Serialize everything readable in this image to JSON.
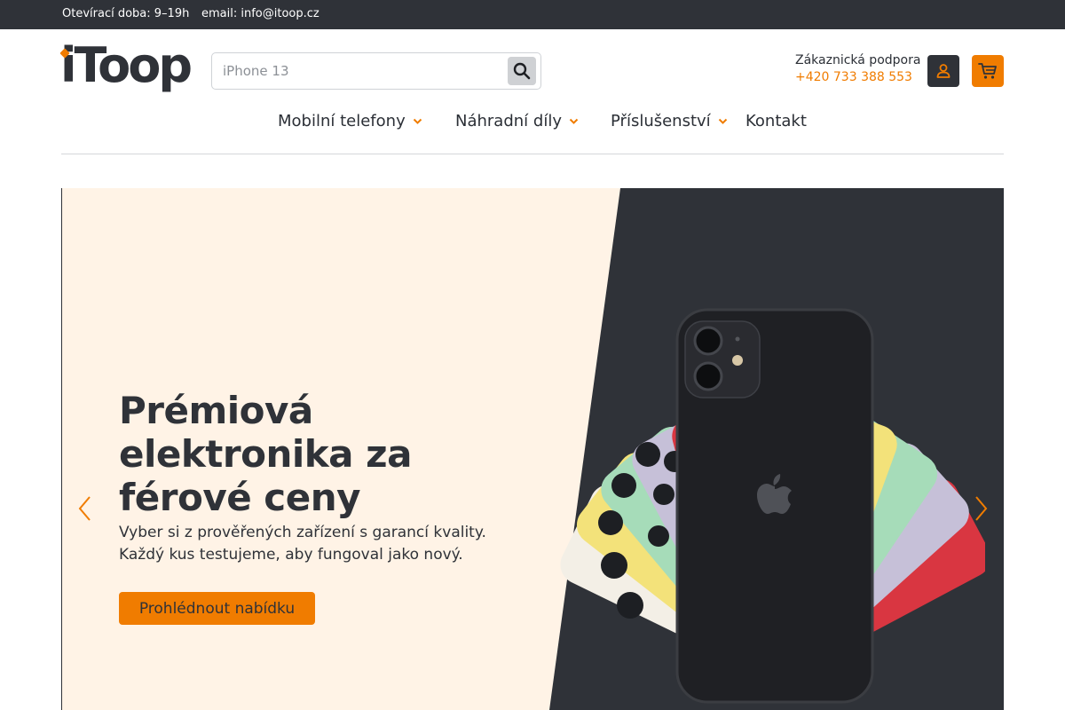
{
  "topbar": {
    "hours": "Otevírací doba: 9–19h",
    "email": "email: info@itoop.cz"
  },
  "header": {
    "logo_text": "iToop",
    "search": {
      "placeholder": "iPhone 13",
      "icon": "search-icon"
    },
    "support": {
      "label": "Zákaznická podpora",
      "phone": "+420 733 388 553"
    },
    "user_icon": "user-icon",
    "cart_icon": "cart-icon"
  },
  "nav": {
    "items": [
      {
        "label": "Mobilní telefony",
        "has_dropdown": true
      },
      {
        "label": "Náhradní díly",
        "has_dropdown": true
      },
      {
        "label": "Příslušenství",
        "has_dropdown": true
      },
      {
        "label": "Kontakt",
        "has_dropdown": false
      }
    ]
  },
  "hero": {
    "title": "Prémiová elektronika za férové ceny",
    "subtitle_line1": "Vyber si z prověřených zařízení s garancí kvality.",
    "subtitle_line2": "Každý kus testujeme, aby fungoval jako nový.",
    "cta_label": "Prohlédnout nabídku",
    "prev_icon": "chevron-left-icon",
    "next_icon": "chevron-right-icon",
    "image": "iphone-fan-image"
  },
  "colors": {
    "accent": "#f07c00",
    "dark": "#2f3238",
    "hero_bg": "#fff3e6"
  }
}
